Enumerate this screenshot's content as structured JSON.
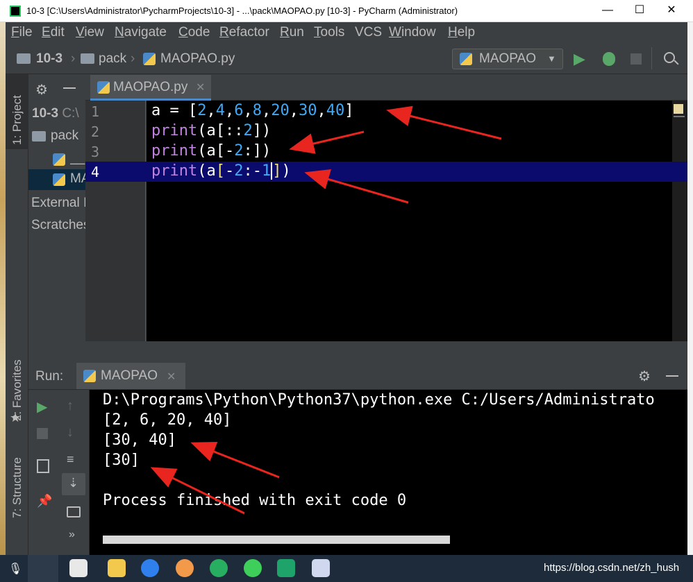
{
  "window": {
    "title": "10-3 [C:\\Users\\Administrator\\PycharmProjects\\10-3] - ...\\pack\\MAOPAO.py [10-3] - PyCharm (Administrator)",
    "minimize": "—",
    "maximize": "☐",
    "close": "✕"
  },
  "menu": [
    {
      "label": "File",
      "mn": "F",
      "rest": "ile"
    },
    {
      "label": "Edit",
      "mn": "E",
      "rest": "dit"
    },
    {
      "label": "View",
      "mn": "V",
      "rest": "iew"
    },
    {
      "label": "Navigate",
      "mn": "N",
      "rest": "avigate"
    },
    {
      "label": "Code",
      "mn": "C",
      "rest": "ode"
    },
    {
      "label": "Refactor",
      "mn": "R",
      "rest": "efactor"
    },
    {
      "label": "Run",
      "mn": "R",
      "rest": "un"
    },
    {
      "label": "Tools",
      "mn": "T",
      "rest": "ools"
    },
    {
      "label": "VCS",
      "mn": "",
      "rest": "VCS"
    },
    {
      "label": "Window",
      "mn": "W",
      "rest": "indow"
    },
    {
      "label": "Help",
      "mn": "H",
      "rest": "elp"
    }
  ],
  "breadcrumb": [
    "10-3",
    "pack",
    "MAOPAO.py"
  ],
  "run_config": "MAOPAO",
  "sidebar_tabs": {
    "project": "1: Project",
    "favorites": "2: Favorites",
    "structure": "7: Structure"
  },
  "project_tree": {
    "root": "10-3",
    "root_path": "C:\\",
    "pack": "pack",
    "init": "__i",
    "file": "MA",
    "external": "External I",
    "scratches": "Scratches"
  },
  "editor": {
    "tab_label": "MAOPAO.py",
    "line_numbers": [
      "1",
      "2",
      "3",
      "4"
    ],
    "lines": {
      "l1": {
        "a": "a = [",
        "n1": "2",
        "n2": "4",
        "n3": "6",
        "n4": "8",
        "n5": "20",
        "n6": "30",
        "n7": "40",
        "sep": ",",
        "end": "]"
      },
      "l2": {
        "kw": "print",
        "pre": "(a[::",
        "num": "2",
        "post": "])"
      },
      "l3": {
        "kw": "print",
        "pre": "(a[-",
        "num": "2",
        "post": ":])"
      },
      "l4": {
        "kw": "print",
        "pre": "(a",
        "br": "[",
        "dash": "-",
        "num1": "2",
        "mid": ":-",
        "num2": "1",
        "close": "]",
        "end": ")"
      }
    }
  },
  "run": {
    "label": "Run:",
    "tab": "MAOPAO",
    "output": [
      "D:\\Programs\\Python\\Python37\\python.exe C:/Users/Administrato",
      "[2, 6, 20, 40]",
      "[30, 40]",
      "[30]",
      "",
      "Process finished with exit code 0"
    ]
  },
  "taskbar": {
    "watermark": "https://blog.csdn.net/zh_hush"
  },
  "colors": {
    "ide_bg": "#3c3f41",
    "editor_bg": "#000000",
    "keyword": "#c183e0",
    "number": "#3fa9f5",
    "current_line": "#0b0b6e",
    "annotation_arrow": "#e8251f"
  }
}
